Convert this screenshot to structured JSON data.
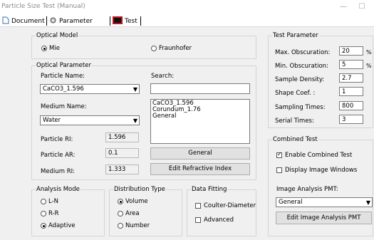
{
  "window": {
    "title": "Particle Size Test (Manual)",
    "minimize": "—",
    "maximize": "☐"
  },
  "tabs": [
    {
      "label": "Document",
      "icon": "document-icon"
    },
    {
      "label": "Parameter",
      "icon": "gear-icon"
    },
    {
      "label": "Test",
      "icon": "test-icon"
    }
  ],
  "optical_model": {
    "legend": "Optical Model",
    "options": [
      "Mie",
      "Fraunhofer"
    ],
    "selected": "Mie"
  },
  "optical_parameter": {
    "legend": "Optical Parameter",
    "particle_name_label": "Particle Name:",
    "particle_name_value": "CaCO3_1.596",
    "search_label": "Search:",
    "search_value": "",
    "medium_name_label": "Medium Name:",
    "medium_name_value": "Water",
    "material_list": [
      "CaCO3_1.596",
      "Corundum_1.76",
      "General"
    ],
    "particle_ri_label": "Particle RI:",
    "particle_ri_value": "1.596",
    "particle_ar_label": "Particle AR:",
    "particle_ar_value": "0.1",
    "medium_ri_label": "Medium RI:",
    "medium_ri_value": "1.333",
    "general_button": "General",
    "edit_ri_button": "Edit Refractive Index"
  },
  "analysis_mode": {
    "legend": "Analysis Mode",
    "options": [
      "L-N",
      "R-R",
      "Adaptive"
    ],
    "selected": "Adaptive"
  },
  "distribution_type": {
    "legend": "Distribution Type",
    "options": [
      "Volume",
      "Area",
      "Number"
    ],
    "selected": "Volume"
  },
  "data_fitting": {
    "legend": "Data Fitting",
    "options": [
      "Coulter-Diameter",
      "Advanced"
    ]
  },
  "test_parameter": {
    "legend": "Test Parameter",
    "rows": [
      {
        "label": "Max. Obscuration:",
        "value": "20",
        "unit": "%"
      },
      {
        "label": "Min. Obscuration:",
        "value": "5",
        "unit": "%"
      },
      {
        "label": "Sample Density:",
        "value": "2.7",
        "unit": ""
      },
      {
        "label": "Shape Coef. :",
        "value": "1",
        "unit": ""
      },
      {
        "label": "Sampling Times:",
        "value": "800",
        "unit": ""
      },
      {
        "label": "Serial Times:",
        "value": "3",
        "unit": ""
      }
    ]
  },
  "combined_test": {
    "legend": "Combined Test",
    "enable_label": "Enable Combined Test",
    "enable_checked": true,
    "display_label": "Display Image Windows",
    "display_checked": false,
    "pmt_label": "Image Analysis PMT:",
    "pmt_value": "General",
    "edit_pmt_button": "Edit Image Analysis PMT"
  }
}
